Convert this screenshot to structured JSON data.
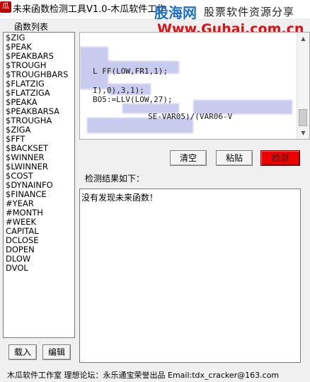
{
  "window": {
    "title": "未来函数检测工具V1.0-木瓜软件工作",
    "app_icon": "瓜"
  },
  "watermark": {
    "logo": "股海网",
    "subtitle": "股票软件资源分享",
    "url": "Www.Guhai.com.cn"
  },
  "function_list": {
    "label": "函数列表",
    "items": [
      "$ZIG",
      "$PEAK",
      "$PEAKBARS",
      "$TROUGH",
      "$TROUGHBARS",
      "$FLATZIG",
      "$FLATZIGA",
      "$PEAKA",
      "$PEAKBARSA",
      "$TROUGHA",
      "$ZIGA",
      "$FFT",
      "$BACKSET",
      "$WINNER",
      "$LWINNER",
      "$COST",
      "$DYNAINFO",
      "$FINANCE",
      "#YEAR",
      "#MONTH",
      "#WEEK",
      "CAPITAL",
      "DCLOSE",
      "DOPEN",
      "DLOW",
      "DVOL"
    ]
  },
  "code_editor": {
    "lines": [
      "L    FF(LOW,FR1,1);",
      "I),0),3,1);",
      "BO5:=LLV(LOW,27);",
      "SE-VAR05)/(VAR06-V"
    ]
  },
  "buttons": {
    "clear": "清空",
    "paste": "粘贴",
    "detect": "检测",
    "load": "载入",
    "edit": "编辑"
  },
  "result": {
    "label": "检测结果如下：",
    "text": "没有发现未来函数！"
  },
  "status_bar": {
    "text": "木瓜软件工作室 理想论坛：永乐通宝荣誉出品   Email:tdx_cracker@163.com"
  },
  "colors": {
    "detect_button": "#ee0000",
    "watermark_blue": "#1f6fd0",
    "watermark_red": "#e01010"
  }
}
